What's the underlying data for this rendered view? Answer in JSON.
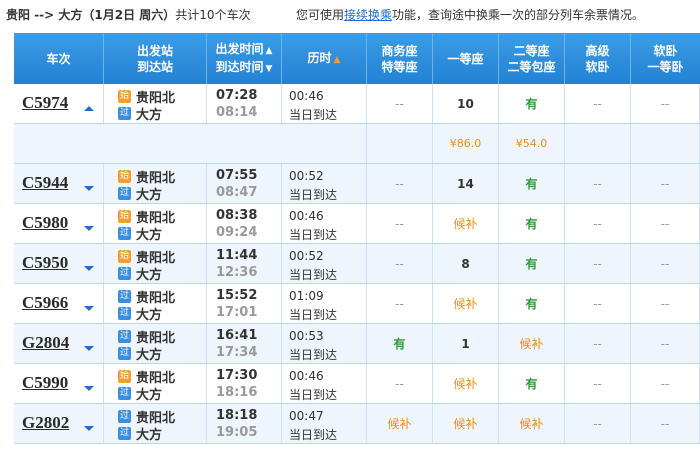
{
  "top": {
    "from": "贵阳",
    "arrow": " --> ",
    "to": "大方",
    "date": "（1月2日  周六）",
    "count": "共计10个车次",
    "tip_pre": "您可使用",
    "tip_link": "接续换乘",
    "tip_post": "功能，查询途中换乘一次的部分列车余票情况。"
  },
  "headers": {
    "train": "车次",
    "station1": "出发站",
    "station2": "到达站",
    "time1": "出发时间",
    "time2": "到达时间",
    "duration": "历时",
    "biz1": "商务座",
    "biz2": "特等座",
    "first": "一等座",
    "second1": "二等座",
    "second2": "二等包座",
    "hisoft1": "高级",
    "hisoft2": "软卧",
    "soft1": "软卧",
    "soft2": "一等卧"
  },
  "badges": {
    "start": "始",
    "pass": "过"
  },
  "rows": [
    {
      "train": "C5974",
      "from": "贵阳北",
      "to": "大方",
      "dep": "07:28",
      "arr": "08:14",
      "dur": "00:46",
      "day": "当日到达",
      "biz": "--",
      "first": "10",
      "second": "有",
      "hisoft": "--",
      "soft": "--",
      "start": true,
      "expanded": true
    },
    {
      "train": "C5944",
      "from": "贵阳北",
      "to": "大方",
      "dep": "07:55",
      "arr": "08:47",
      "dur": "00:52",
      "day": "当日到达",
      "biz": "--",
      "first": "14",
      "second": "有",
      "hisoft": "--",
      "soft": "--",
      "start": true
    },
    {
      "train": "C5980",
      "from": "贵阳北",
      "to": "大方",
      "dep": "08:38",
      "arr": "09:24",
      "dur": "00:46",
      "day": "当日到达",
      "biz": "--",
      "first": "候补",
      "second": "有",
      "hisoft": "--",
      "soft": "--",
      "start": true
    },
    {
      "train": "C5950",
      "from": "贵阳北",
      "to": "大方",
      "dep": "11:44",
      "arr": "12:36",
      "dur": "00:52",
      "day": "当日到达",
      "biz": "--",
      "first": "8",
      "second": "有",
      "hisoft": "--",
      "soft": "--",
      "start": true
    },
    {
      "train": "C5966",
      "from": "贵阳北",
      "to": "大方",
      "dep": "15:52",
      "arr": "17:01",
      "dur": "01:09",
      "day": "当日到达",
      "biz": "--",
      "first": "候补",
      "second": "有",
      "hisoft": "--",
      "soft": "--",
      "start": false
    },
    {
      "train": "G2804",
      "from": "贵阳北",
      "to": "大方",
      "dep": "16:41",
      "arr": "17:34",
      "dur": "00:53",
      "day": "当日到达",
      "biz": "有",
      "first": "1",
      "second": "候补",
      "hisoft": "--",
      "soft": "--",
      "start": false
    },
    {
      "train": "C5990",
      "from": "贵阳北",
      "to": "大方",
      "dep": "17:30",
      "arr": "18:16",
      "dur": "00:46",
      "day": "当日到达",
      "biz": "--",
      "first": "候补",
      "second": "有",
      "hisoft": "--",
      "soft": "--",
      "start": true
    },
    {
      "train": "G2802",
      "from": "贵阳北",
      "to": "大方",
      "dep": "18:18",
      "arr": "19:05",
      "dur": "00:47",
      "day": "当日到达",
      "biz": "候补",
      "first": "候补",
      "second": "候补",
      "hisoft": "--",
      "soft": "--",
      "start": false
    }
  ],
  "price_row": {
    "first": "¥86.0",
    "second": "¥54.0"
  },
  "colors": {
    "header_blue": "#2281d4",
    "available_green": "#2e9d3a",
    "waitlist_orange": "#f08b1a"
  }
}
